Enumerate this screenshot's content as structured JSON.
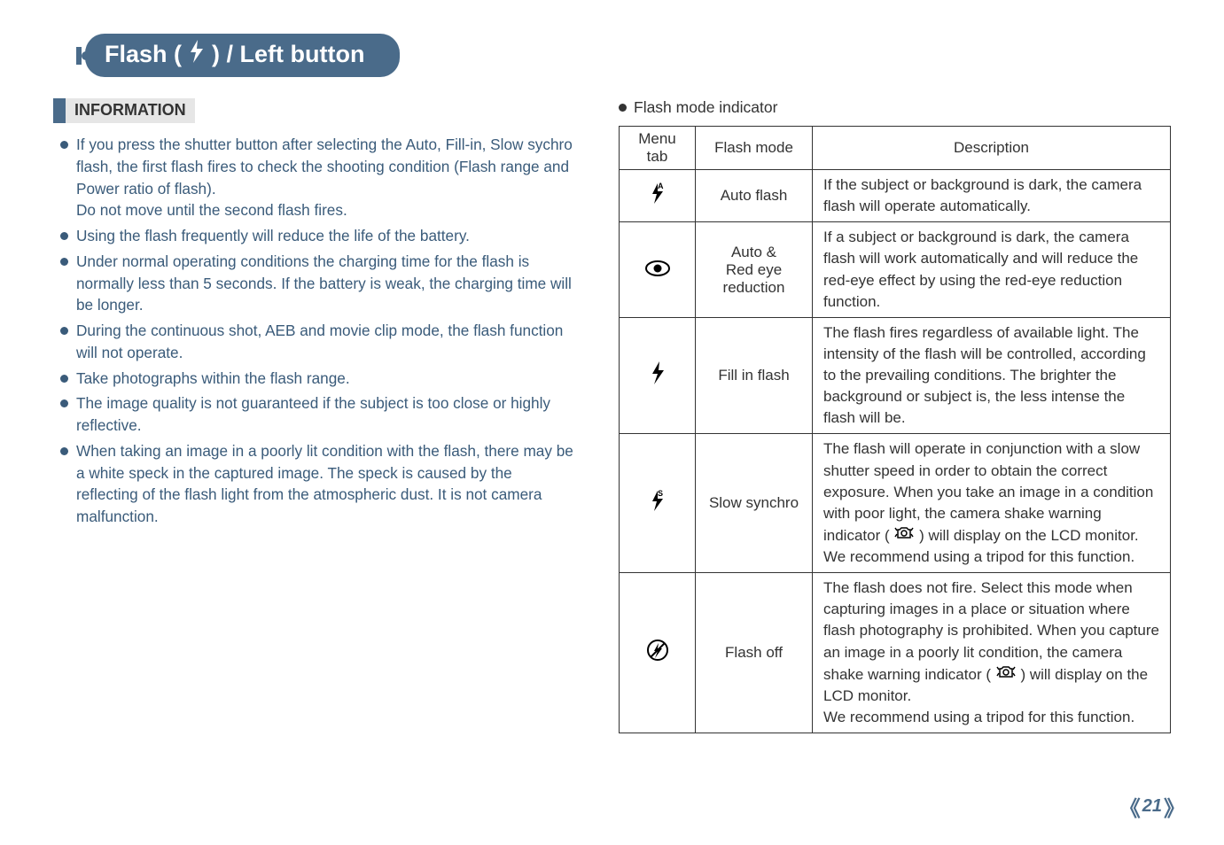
{
  "title": {
    "prefix": "Flash (",
    "suffix": ") / Left button"
  },
  "info": {
    "heading": "INFORMATION",
    "items": [
      "If you press the shutter button after selecting the Auto, Fill-in, Slow sychro flash, the first flash fires to check the shooting condition (Flash range and Power ratio of flash).",
      "Using the flash frequently will reduce the life of the battery.",
      "Under normal operating conditions the charging time for the flash is normally less than 5 seconds. If the battery is weak, the charging time will be longer.",
      "During the continuous shot, AEB and movie clip mode, the flash function will not operate.",
      "Take photographs within the flash range.",
      "The image quality is not guaranteed if the subject is too close or highly reflective.",
      "When taking an image in a poorly lit condition with the flash, there may be a white speck in the captured image. The speck is caused by the reflecting of the flash light from the atmospheric dust. It is not camera malfunction."
    ],
    "sub_after_first": "Do not move until the second flash fires."
  },
  "table": {
    "lead": "Flash mode indicator",
    "headers": {
      "menu": "Menu tab",
      "mode": "Flash mode",
      "desc": "Description"
    },
    "rows": [
      {
        "icon": "auto-flash-icon",
        "mode": "Auto flash",
        "desc": "If the subject or background is dark, the camera flash will operate automatically."
      },
      {
        "icon": "redeye-icon",
        "mode": "Auto &\nRed eye\nreduction",
        "desc": "If a subject or background is dark, the camera flash will work automatically and will reduce the red-eye effect by using the red-eye reduction function."
      },
      {
        "icon": "fill-flash-icon",
        "mode": "Fill in flash",
        "desc": "The flash fires regardless of available light. The intensity of the flash will be controlled, according to the prevailing conditions. The brighter the background or subject is, the less intense the flash will be."
      },
      {
        "icon": "slow-synchro-icon",
        "mode": "Slow synchro",
        "desc_parts": {
          "a": "The flash will operate in conjunction with a slow shutter speed in order to obtain the correct exposure. When you take an image in a condition with poor light, the camera shake warning indicator (",
          "b": ") will display on the LCD monitor.",
          "c": "We recommend using a tripod for this function."
        }
      },
      {
        "icon": "flash-off-icon",
        "mode": "Flash off",
        "desc_parts": {
          "a": "The flash does not fire. Select this mode when capturing images in a place or situation where flash photography is prohibited. When you capture an image in a poorly lit condition, the camera shake warning indicator (",
          "b": ") will display on the LCD monitor.",
          "c": "We recommend using a tripod for this function."
        }
      }
    ]
  },
  "page_number": "21"
}
